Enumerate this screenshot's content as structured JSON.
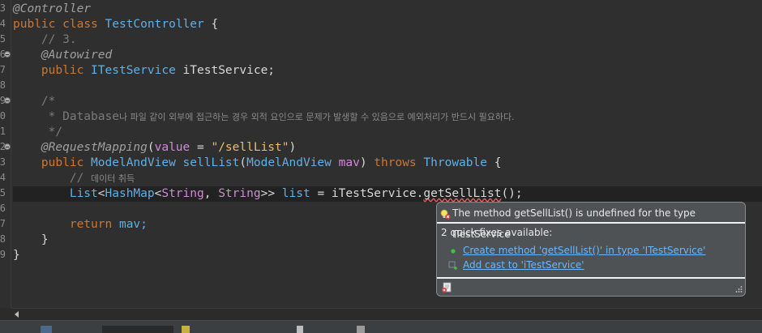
{
  "gutter": {
    "line_numbers": [
      "3",
      "4",
      "5",
      "6",
      "7",
      "8",
      "9",
      "0",
      "1",
      "2",
      "3",
      "4",
      "5",
      "6",
      "7",
      "8",
      "9"
    ]
  },
  "code": {
    "l1_annotation": "@Controller",
    "l2_public": "public",
    "l2_class": "class",
    "l2_name": "TestController",
    "l2_brace": " {",
    "l3_comment": "// 3.",
    "l4_annotation": "@Autowired",
    "l5_public": "public",
    "l5_type": "ITestService",
    "l5_field": " iTestService;",
    "l7_open": "/*",
    "l8_star": " * Database",
    "l8_korean": "나 파일 같이 외부에 접근하는 경우 외적 요인으로 문제가 발생할 수 있음으로 예외처리가 반드시 필요하다.",
    "l9_close": " */",
    "l10_annotation": "@RequestMapping",
    "l10_open": "(",
    "l10_param": "value",
    "l10_eq": " = ",
    "l10_str": "\"/sellList\"",
    "l10_close": ")",
    "l11_public": "public",
    "l11_rtype": "ModelAndView",
    "l11_method": "sellList",
    "l11_open": "(",
    "l11_ptype": "ModelAndView",
    "l11_pname": " mav",
    "l11_close": ") ",
    "l11_throws": "throws",
    "l11_exc": "Throwable",
    "l11_brace": " {",
    "l12_slashes": "// ",
    "l12_korean": "데이터 취득",
    "l13_list": "List",
    "l13_lt1": "<",
    "l13_hashmap": "HashMap",
    "l13_lt2": "<",
    "l13_string1": "String",
    "l13_comma": ", ",
    "l13_string2": "String",
    "l13_gt": ">> ",
    "l13_var": "list",
    "l13_eq": " = iTestService.",
    "l13_call": "getSellList",
    "l13_end": "();",
    "l15_return": "return",
    "l15_mav": " mav;",
    "l16_brace": "}",
    "l17_brace": "}"
  },
  "popup": {
    "title": "The method getSellList() is undefined for the type ITestService",
    "subtitle": "2 quick fixes available:",
    "fixes": [
      {
        "label": "Create method 'getSellList()' in type 'ITestService'",
        "icon": "green-dot-icon"
      },
      {
        "label": "Add cast to 'iTestService'",
        "icon": "cast-icon"
      }
    ]
  },
  "colors": {
    "background": "#2f2f2f",
    "keyword": "#cc7832",
    "type": "#5fb0e6",
    "string": "#e8bf6a",
    "popup_bg": "#4e5254",
    "link": "#69b7ff"
  }
}
